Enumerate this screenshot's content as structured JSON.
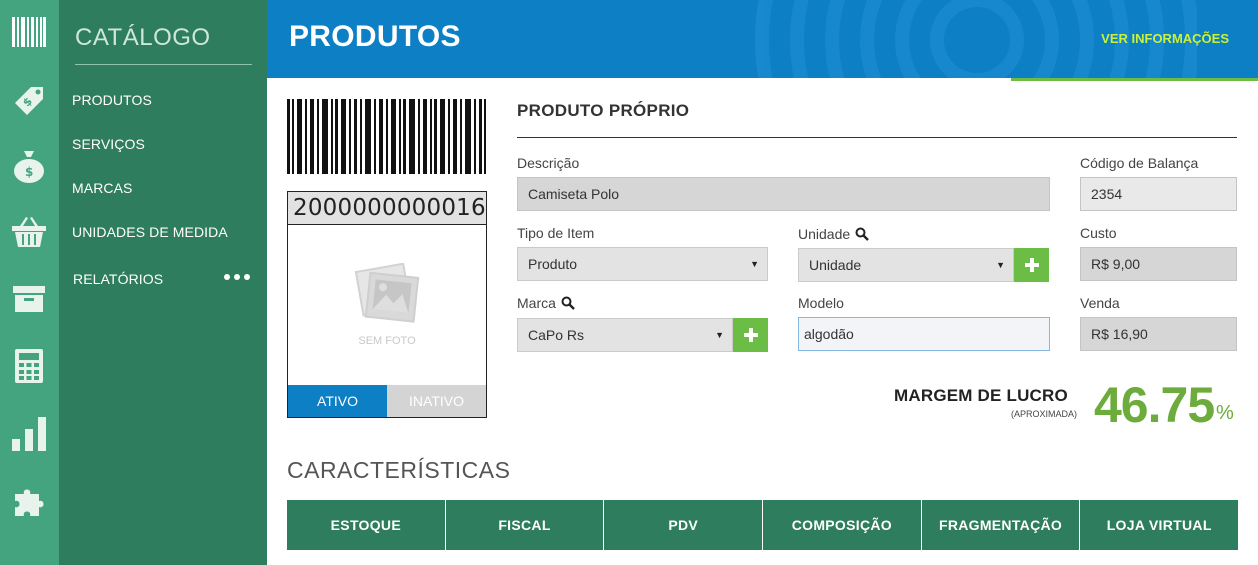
{
  "rail": {
    "icons": [
      "barcode-icon",
      "price-tag-icon",
      "money-bag-icon",
      "basket-icon",
      "archive-box-icon",
      "calculator-icon",
      "bar-chart-icon",
      "puzzle-icon"
    ]
  },
  "sidebar": {
    "title": "CATÁLOGO",
    "items": [
      {
        "label": "PRODUTOS"
      },
      {
        "label": "SERVIÇOS"
      },
      {
        "label": "MARCAS"
      },
      {
        "label": "UNIDADES DE MEDIDA"
      },
      {
        "label": "RELATÓRIOS"
      }
    ]
  },
  "header": {
    "title": "PRODUTOS",
    "info_link": "VER INFORMAÇÕES"
  },
  "product_card": {
    "barcode_number": "2000000000016",
    "no_photo_label": "SEM FOTO",
    "status_active": "ATIVO",
    "status_inactive": "INATIVO",
    "selected_status": "ATIVO"
  },
  "form": {
    "section_title": "PRODUTO PRÓPRIO",
    "descricao": {
      "label": "Descrição",
      "value": "Camiseta Polo"
    },
    "codigo_balanca": {
      "label": "Código de Balança",
      "value": "2354"
    },
    "tipo_item": {
      "label": "Tipo de Item",
      "value": "Produto"
    },
    "unidade": {
      "label": "Unidade",
      "value": "Unidade"
    },
    "custo": {
      "label": "Custo",
      "value": "R$ 9,00"
    },
    "marca": {
      "label": "Marca",
      "value": "CaPo Rs"
    },
    "modelo": {
      "label": "Modelo",
      "value": "algodão"
    },
    "venda": {
      "label": "Venda",
      "value": "R$ 16,90"
    }
  },
  "profit": {
    "label": "MARGEM DE LUCRO",
    "sublabel": "(APROXIMADA)",
    "value": "46.75",
    "unit": "%"
  },
  "characteristics": {
    "title": "CARACTERÍSTICAS",
    "tabs": [
      "ESTOQUE",
      "FISCAL",
      "PDV",
      "COMPOSIÇÃO",
      "FRAGMENTAÇÃO",
      "LOJA VIRTUAL"
    ]
  },
  "colors": {
    "rail": "#43a47f",
    "sidebar": "#2e7d5e",
    "header": "#0d7fc4",
    "accent_green": "#6cbd45",
    "profit_green": "#6cab3c",
    "link_yellow": "#c8f03c"
  }
}
